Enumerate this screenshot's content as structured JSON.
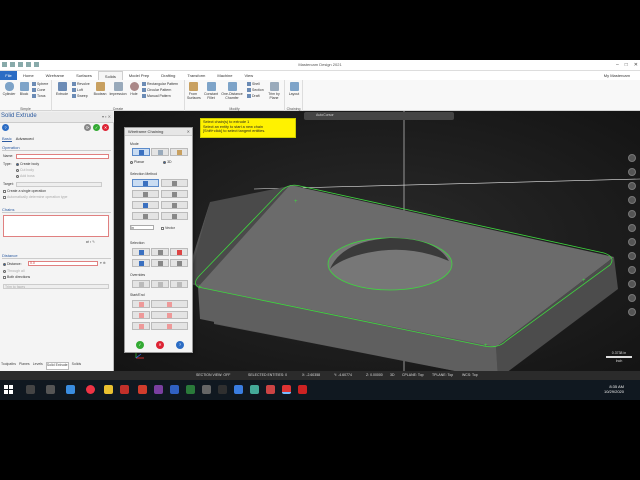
{
  "app": {
    "window_title": "Mastercam Design 2021",
    "user": "My Mastercam",
    "menu_file": "File",
    "menu_tabs": [
      "Home",
      "Wireframe",
      "Surfaces",
      "Solids",
      "Model Prep",
      "Drafting",
      "Transform",
      "Machine",
      "View"
    ],
    "active_tab": "Solids"
  },
  "ribbon": {
    "simple_label": "Simple",
    "create_label": "Create",
    "modify_label": "Modify",
    "layout_label": "Layout",
    "cylinder": "Cylinder",
    "block": "Block",
    "sphere": "Sphere",
    "cone": "Cone",
    "torus": "Torus",
    "extrude": "Extrude",
    "revolve": "Revolve",
    "loft": "Loft",
    "sweep": "Sweep",
    "boolean": "Boolean",
    "impression": "Impression",
    "hole": "Hole",
    "rect_pattern": "Rectangular Pattern",
    "circ_pattern": "Circular Pattern",
    "manual_pattern": "Manual Pattern",
    "fillet": "Fillet",
    "chamfer": "Chamfer",
    "from_surfaces": "From Surfaces",
    "constant_fillet": "Constant Fillet",
    "one_distance_chamfer": "One-Distance Chamfer",
    "shell": "Shell",
    "section": "Section",
    "draft": "Draft",
    "trim_by_plane": "Trim by Plane",
    "layout": "Layout",
    "chaining": "Chaining"
  },
  "solid_extrude": {
    "title": "Solid Extrude",
    "tab_basic": "Basic",
    "tab_advanced": "Advanced",
    "operation_header": "Operation",
    "name_label": "Name:",
    "type_label": "Type:",
    "type_create": "Create body",
    "type_cut": "Cut body",
    "type_add": "Add boss",
    "target_label": "Target:",
    "single_op": "Create a single operation",
    "auto_determine": "Automatically determine operation type",
    "chains_header": "Chains",
    "distance_header": "Distance",
    "distance_label": "Distance:",
    "distance_value": "0.0",
    "through_all": "Through all",
    "both_directions": "Both directions",
    "trim_to_faces": "Trim to faces"
  },
  "bottom_tabs": [
    "Toolpaths",
    "Planes",
    "Levels",
    "Solid Extrude",
    "Solids"
  ],
  "active_bottom_tab": "Solid Extrude",
  "tooltip": {
    "line1": "Select chain(s) to extrude 1",
    "line2": "Select an entity to start a new chain",
    "line3": "[Shift+click] to select tangent entities."
  },
  "wireframe_chaining": {
    "title": "Wireframe Chaining",
    "mode": "Mode",
    "plane_label": "Planar",
    "threed_label": "3D",
    "selection_method": "Selection Method",
    "selection": "Selection",
    "end_label": "Start/End",
    "overrides": "Overrides",
    "vector_label": "Vector",
    "dropdown_value": "In"
  },
  "viewport": {
    "toolbar_text": "AutoCursor"
  },
  "statusbar": {
    "section_view": "SECTION VIEW: OFF",
    "selected": "SELECTED ENTITIES: 0",
    "x": "X: -2.60358",
    "y": "Y: -4.60774",
    "z": "Z: 0.00000",
    "dim": "3D",
    "cplane": "CPLANE: Top",
    "tplane": "TPLANE: Top",
    "wcs": "WCS: Top"
  },
  "scale": {
    "value": "0.3738 in",
    "unit": "Inch"
  },
  "taskbar": {
    "time": "8:35 AM",
    "date": "10/29/2020"
  },
  "colors": {
    "accent": "#2b6cc4",
    "chain_green": "#3fd63f",
    "tooltip_yellow": "#fff200",
    "part_grey": "#666666"
  }
}
